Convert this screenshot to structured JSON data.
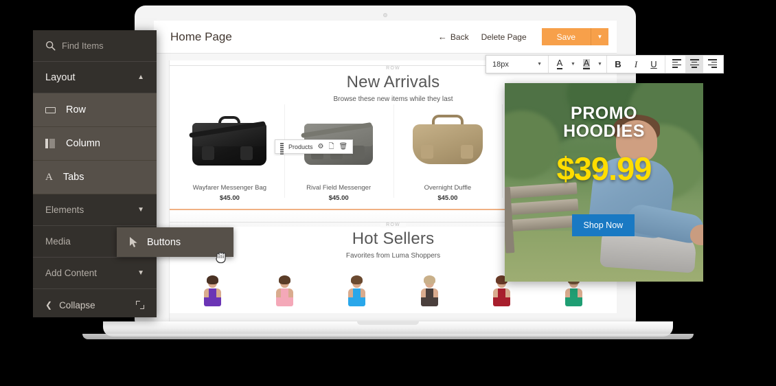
{
  "app": {
    "page_title": "Home Page"
  },
  "header": {
    "back_label": "Back",
    "back_icon": "arrow-left-icon",
    "delete_label": "Delete Page",
    "save_label": "Save",
    "save_caret_icon": "chevron-down-icon"
  },
  "format_toolbar": {
    "font_size": "18px",
    "font_size_caret_icon": "chevron-down-icon",
    "font_color_icon": "font-color-icon",
    "font_color_caret_icon": "chevron-down-icon",
    "highlight_color_icon": "highlight-color-icon",
    "highlight_caret_icon": "chevron-down-icon",
    "bold_label": "B",
    "italic_label": "I",
    "underline_label": "U",
    "align_left_icon": "align-left-icon",
    "align_center_icon": "align-center-icon",
    "align_right_icon": "align-right-icon",
    "active_alignment": "center"
  },
  "sidebar": {
    "search": {
      "icon": "search-icon",
      "placeholder": "Find Items"
    },
    "groups": [
      {
        "label": "Layout",
        "icon": "chevron-up-icon",
        "expanded": true
      },
      {
        "label": "Elements",
        "icon": "chevron-down-icon",
        "expanded": false
      },
      {
        "label": "Media",
        "icon": "",
        "expanded": false
      },
      {
        "label": "Add Content",
        "icon": "chevron-down-icon",
        "expanded": false
      }
    ],
    "items": [
      {
        "label": "Row",
        "icon": "row-icon"
      },
      {
        "label": "Column",
        "icon": "column-icon"
      },
      {
        "label": "Tabs",
        "icon": "text-A-icon"
      }
    ],
    "collapse": {
      "label": "Collapse",
      "chevron_icon": "chevron-left-icon",
      "expand_icon": "expand-icon"
    },
    "flyout": {
      "label": "Buttons",
      "icon": "pointer-arrow-icon"
    },
    "cursor": "grab-hand-cursor"
  },
  "canvas": {
    "row_label": "ROW",
    "sections": [
      {
        "title": "New Arrivals",
        "subtitle": "Browse these new items while they last"
      },
      {
        "title": "Hot Sellers",
        "subtitle": "Favorites from Luma Shoppers"
      }
    ],
    "widget_toolbar": {
      "grip_icon": "drag-grip-icon",
      "label": "Products",
      "settings_icon": "gear-icon",
      "duplicate_icon": "copy-icon",
      "delete_icon": "trash-icon"
    },
    "products": [
      {
        "name": "Wayfarer Messenger Bag",
        "price": "$45.00",
        "color": "#1b1b1b"
      },
      {
        "name": "Rival Field Messenger",
        "price": "$45.00",
        "color": "#6f6f6a"
      },
      {
        "name": "Overnight Duffle",
        "price": "$45.00",
        "color": "#b09a70"
      },
      {
        "name": "",
        "price": "",
        "color": "#3d3a38"
      }
    ],
    "models": [
      {
        "top_color": "#6b35b5",
        "hair_color": "#4a3224"
      },
      {
        "top_color": "#f4a8b8",
        "hair_color": "#5b3d28"
      },
      {
        "top_color": "#2aa7ea",
        "hair_color": "#6b4a30"
      },
      {
        "top_color": "#4a3f3c",
        "hair_color": "#c9b08a"
      },
      {
        "top_color": "#a81f2d",
        "hair_color": "#6b3b28"
      },
      {
        "top_color": "#1f9e73",
        "hair_color": "#7a5a3c"
      }
    ]
  },
  "promo": {
    "line1": "PROMO",
    "line2": "HOODIES",
    "price": "$39.99",
    "cta_label": "Shop Now",
    "cta_color": "#1979c3",
    "price_color": "#ffdd00"
  },
  "colors": {
    "accent_orange": "#f7a04a",
    "sidebar_dark": "#33302c",
    "sidebar_item": "#565049",
    "promo_blue": "#1979c3"
  }
}
